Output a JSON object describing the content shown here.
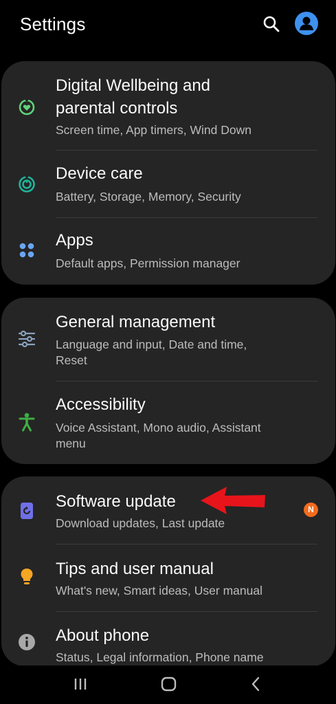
{
  "header": {
    "title": "Settings"
  },
  "icons": {
    "search": "search-icon",
    "profile": "profile-icon",
    "digital_wellbeing": "digital-wellbeing-icon",
    "device_care": "device-care-icon",
    "apps": "apps-grid-icon",
    "general_management": "sliders-icon",
    "accessibility": "accessibility-icon",
    "software_update": "software-update-icon",
    "tips": "lightbulb-icon",
    "about": "info-icon",
    "nav_recents": "recents-icon",
    "nav_home": "home-icon",
    "nav_back": "back-icon"
  },
  "colors": {
    "background": "#000000",
    "card": "#252525",
    "accent_blue": "#3e91ee",
    "wellbeing_green": "#5fd37a",
    "device_care_teal": "#1fb39a",
    "apps_blue": "#6aa6f5",
    "sliders_gray": "#8aa2bd",
    "accessibility_green": "#3fae45",
    "software_update_purple": "#6f6fe8",
    "tips_orange": "#f5a623",
    "about_gray": "#a8a8a8",
    "badge_orange": "#f26b1d",
    "annotation_red": "#e8141b"
  },
  "groups": [
    {
      "items": [
        {
          "title_line1": "Digital Wellbeing and",
          "title_line2": "parental controls",
          "subtitle": "Screen time, App timers, Wind Down"
        },
        {
          "title": "Device care",
          "subtitle": "Battery, Storage, Memory, Security"
        },
        {
          "title": "Apps",
          "subtitle": "Default apps, Permission manager"
        }
      ]
    },
    {
      "items": [
        {
          "title": "General management",
          "subtitle_line1": "Language and input, Date and time,",
          "subtitle_line2": "Reset"
        },
        {
          "title": "Accessibility",
          "subtitle_line1": "Voice Assistant, Mono audio, Assistant",
          "subtitle_line2": "menu"
        }
      ]
    },
    {
      "items": [
        {
          "title": "Software update",
          "subtitle": "Download updates, Last update",
          "badge": "N"
        },
        {
          "title": "Tips and user manual",
          "subtitle": "What's new, Smart ideas, User manual"
        },
        {
          "title": "About phone",
          "subtitle": "Status, Legal information, Phone name"
        }
      ]
    }
  ]
}
